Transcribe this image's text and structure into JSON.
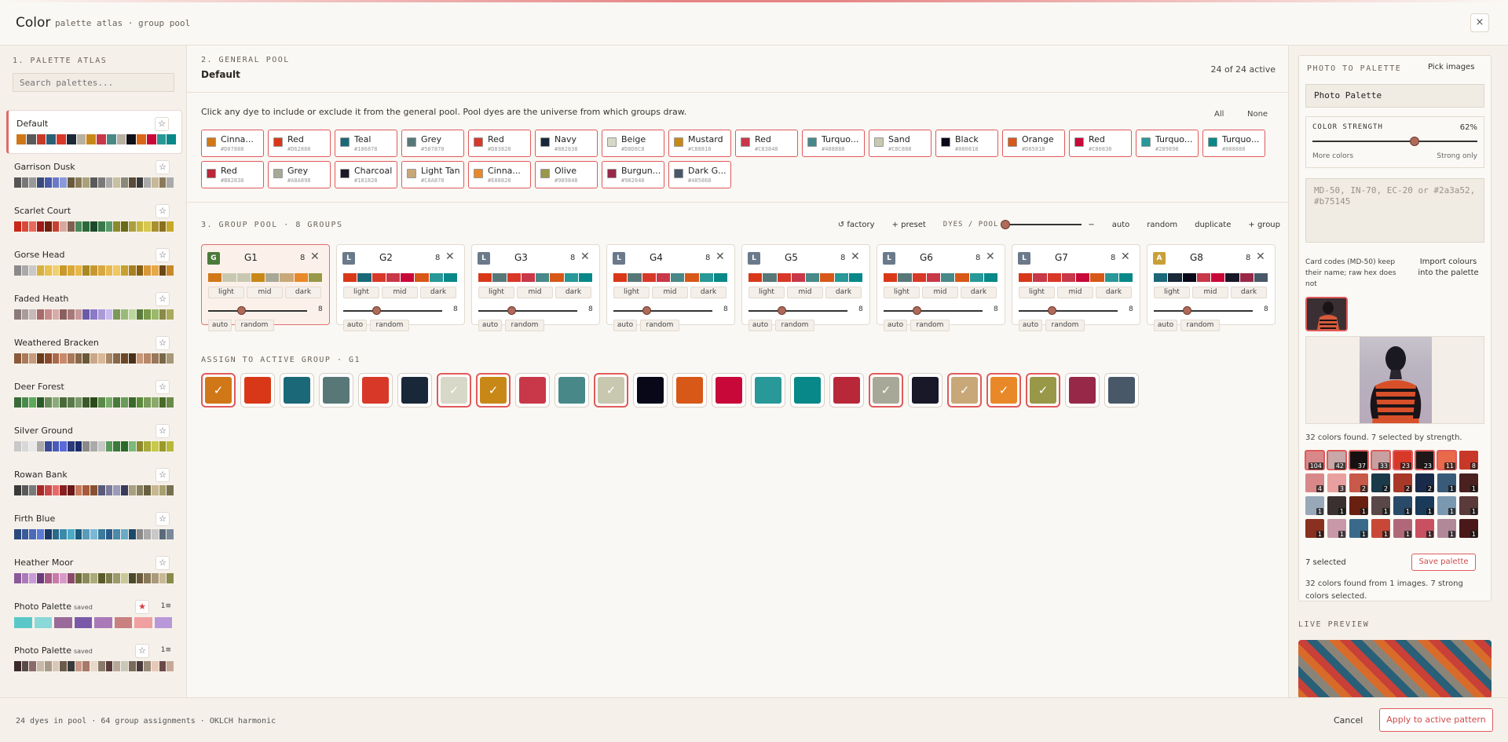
{
  "header": {
    "title": "Color",
    "subtitle": "palette atlas · group pool",
    "close_label": "×"
  },
  "sidebar": {
    "section_label": "1. PALETTE ATLAS",
    "search_placeholder": "Search palettes...",
    "palettes": [
      {
        "name": "Default",
        "active": true,
        "starred": false,
        "colors": [
          "#d07818",
          "#5a5a5a",
          "#c83a28",
          "#2a5f78",
          "#d83828",
          "#1a2838",
          "#b8b0a0",
          "#c88818",
          "#c83848",
          "#4a8888",
          "#b8b0a0",
          "#101018",
          "#d86818",
          "#c80838",
          "#289898",
          "#088888"
        ]
      },
      {
        "name": "Garrison Dusk",
        "starred": false,
        "colors": [
          "#555",
          "#777",
          "#999",
          "#3a4a7a",
          "#4a5aaa",
          "#6a7ac8",
          "#8a9ad8",
          "#6a5a3a",
          "#8a7a5a",
          "#aaa07a",
          "#5a5a5a",
          "#7a7a7a",
          "#aaa",
          "#c8c0a0",
          "#8a8878",
          "#5a4a3a",
          "#3a3a3a",
          "#aaa",
          "#c8b898",
          "#8a7a5a",
          "#aaa"
        ]
      },
      {
        "name": "Scarlet Court",
        "starred": false,
        "colors": [
          "#c8281a",
          "#d84a3a",
          "#e86a5a",
          "#a01818",
          "#702010",
          "#c84030",
          "#d8a8a0",
          "#806050",
          "#4a8a5a",
          "#2a6a3a",
          "#1a4a2a",
          "#3a7a4a",
          "#5a9a6a",
          "#8a8a2a",
          "#6a6a1a",
          "#aaa040",
          "#c8b840",
          "#d8c850",
          "#a89030",
          "#887020",
          "#c8a828"
        ]
      },
      {
        "name": "Gorse Head",
        "starred": false,
        "colors": [
          "#8a8a8a",
          "#aaa",
          "#c8c8c8",
          "#d8b040",
          "#e8c050",
          "#f0d070",
          "#c89828",
          "#d8a838",
          "#e8b848",
          "#a88820",
          "#c89830",
          "#d8a840",
          "#e8b850",
          "#f0c860",
          "#c8a030",
          "#a88020",
          "#886010",
          "#d89838",
          "#e8a848",
          "#6a4818",
          "#c88828"
        ]
      },
      {
        "name": "Faded Heath",
        "starred": false,
        "colors": [
          "#8a7a7a",
          "#aa9a9a",
          "#c8b8b8",
          "#a86a6a",
          "#c88a8a",
          "#d8aaaa",
          "#886060",
          "#a87878",
          "#c89898",
          "#6a5aa8",
          "#8a7ac8",
          "#aa9ad8",
          "#c8baf0",
          "#7a9a5a",
          "#9aba7a",
          "#bad89a",
          "#5a7a3a",
          "#7a9a4a",
          "#9aba6a",
          "#8a8a4a",
          "#aaaa5a"
        ]
      },
      {
        "name": "Weathered Bracken",
        "starred": false,
        "colors": [
          "#8a5a3a",
          "#aa7a5a",
          "#c89a7a",
          "#6a3a1a",
          "#8a4a2a",
          "#aa6a4a",
          "#c88a6a",
          "#a87858",
          "#886848",
          "#6a5838",
          "#c8a888",
          "#d8b898",
          "#a88868",
          "#886848",
          "#6a4828",
          "#4a3018",
          "#c89878",
          "#b88868",
          "#987858",
          "#786848",
          "#a89878"
        ]
      },
      {
        "name": "Deer Forest",
        "starred": false,
        "colors": [
          "#3a6a3a",
          "#4a8a4a",
          "#5aaa5a",
          "#2a5a2a",
          "#6a8a5a",
          "#8aaa7a",
          "#4a6a3a",
          "#5a7a4a",
          "#7a9a6a",
          "#3a5a2a",
          "#2a4a1a",
          "#5a8a4a",
          "#7aaa6a",
          "#4a7a3a",
          "#6a9a5a",
          "#3a6a2a",
          "#5a8a3a",
          "#7a9a5a",
          "#8aaa6a",
          "#4a6a2a",
          "#6a8a4a"
        ]
      },
      {
        "name": "Silver Ground",
        "starred": false,
        "colors": [
          "#c8c8c8",
          "#d8d8d8",
          "#e8e8e8",
          "#aaaaaa",
          "#3a4a9a",
          "#4a5aba",
          "#5a6ad8",
          "#2a3a7a",
          "#1a2a6a",
          "#8a8a8a",
          "#aaaaaa",
          "#c8c8c8",
          "#5a9a5a",
          "#3a7a3a",
          "#2a6a2a",
          "#7aba7a",
          "#8a8a2a",
          "#aaaa3a",
          "#c8c84a",
          "#9a9a2a",
          "#b8b838"
        ]
      },
      {
        "name": "Rowan Bank",
        "starred": false,
        "colors": [
          "#3a3a3a",
          "#5a5a5a",
          "#7a7a7a",
          "#a82828",
          "#c84848",
          "#e86868",
          "#882020",
          "#6a1818",
          "#c87a5a",
          "#a85a3a",
          "#885030",
          "#5a5a7a",
          "#7a7a9a",
          "#9a9aba",
          "#3a3a5a",
          "#a8a080",
          "#888060",
          "#686040",
          "#c8b890",
          "#a8a070",
          "#787050"
        ]
      },
      {
        "name": "Firth Blue",
        "starred": false,
        "colors": [
          "#2a4a7a",
          "#3a5a9a",
          "#4a6aba",
          "#5a7ad8",
          "#1a3a6a",
          "#2a6a8a",
          "#3a8aaa",
          "#4aaac8",
          "#1a5a7a",
          "#5a9aba",
          "#7ab8d8",
          "#3a7a9a",
          "#2a5a8a",
          "#4a8aaa",
          "#6aaac8",
          "#1a4a6a",
          "#8a8a8a",
          "#aaaaaa",
          "#c8c8c8",
          "#5a6a7a",
          "#7a8a9a"
        ]
      },
      {
        "name": "Heather Moor",
        "starred": false,
        "colors": [
          "#8a5a9a",
          "#aa7aba",
          "#c89ad8",
          "#6a3a7a",
          "#a85a8a",
          "#c87aaa",
          "#d89ac8",
          "#8a4a6a",
          "#6a6a3a",
          "#8a8a5a",
          "#aaaa7a",
          "#5a5a2a",
          "#7a7a4a",
          "#9a9a6a",
          "#c8c89a",
          "#4a4a2a",
          "#6a5a3a",
          "#8a7a5a",
          "#aa9a7a",
          "#c8b898",
          "#8a8a4a"
        ]
      },
      {
        "name": "Photo Palette",
        "saved": "saved",
        "starred": true,
        "count_label": "1≡",
        "big": true,
        "colors": [
          "#5ac8c8",
          "#8ad8d8",
          "#9a6a9a",
          "#7a5aa8",
          "#aa7ab8",
          "#c88080",
          "#f0a0a0",
          "#b898d8"
        ]
      },
      {
        "name": "Photo Palette",
        "saved": "saved",
        "starred": false,
        "count_label": "1≡",
        "colors": [
          "#3a2a2a",
          "#5a4a4a",
          "#8a6a6a",
          "#c8b8a8",
          "#aa9a8a",
          "#d8c8b8",
          "#6a5a4a",
          "#3a3a3a",
          "#c89888",
          "#a87868",
          "#e8d8c8",
          "#8a7a6a",
          "#5a3a3a",
          "#b8a898",
          "#c8c8b8",
          "#7a6a5a",
          "#4a3a3a",
          "#9a8a7a",
          "#e8c8b8",
          "#6a4a4a",
          "#c8a898"
        ]
      }
    ]
  },
  "general": {
    "section_label": "2. GENERAL POOL",
    "title": "Default",
    "count_text": "24 of 24 active",
    "hint": "Click any dye to include or exclude it from the general pool. Pool dyes are the universe from which groups draw.",
    "all_label": "All",
    "none_label": "None",
    "dyes": [
      {
        "name": "Cinna...",
        "hex": "#D07888",
        "color": "#d07818"
      },
      {
        "name": "Red",
        "hex": "#D62888",
        "color": "#d83818"
      },
      {
        "name": "Teal",
        "hex": "#186878",
        "color": "#1a6878"
      },
      {
        "name": "Grey",
        "hex": "#587878",
        "color": "#587878"
      },
      {
        "name": "Red",
        "hex": "#D83828",
        "color": "#d83828"
      },
      {
        "name": "Navy",
        "hex": "#882838",
        "color": "#182838"
      },
      {
        "name": "Beige",
        "hex": "#D8D8C8",
        "color": "#d8d8c8"
      },
      {
        "name": "Mustard",
        "hex": "#C88818",
        "color": "#c88818"
      },
      {
        "name": "Red",
        "hex": "#C83848",
        "color": "#c83848"
      },
      {
        "name": "Turquo...",
        "hex": "#488888",
        "color": "#488888"
      },
      {
        "name": "Sand",
        "hex": "#C8C888",
        "color": "#c8c8b0"
      },
      {
        "name": "Black",
        "hex": "#080818",
        "color": "#080818"
      },
      {
        "name": "Orange",
        "hex": "#D85818",
        "color": "#d85818"
      },
      {
        "name": "Red",
        "hex": "#C80838",
        "color": "#c80838"
      },
      {
        "name": "Turquo...",
        "hex": "#289898",
        "color": "#289898"
      },
      {
        "name": "Turquo...",
        "hex": "#088888",
        "color": "#088888"
      },
      {
        "name": "Red",
        "hex": "#B82838",
        "color": "#b82838"
      },
      {
        "name": "Grey",
        "hex": "#A8A898",
        "color": "#a8a898"
      },
      {
        "name": "Charcoal",
        "hex": "#181828",
        "color": "#181828"
      },
      {
        "name": "Light Tan",
        "hex": "#C8A878",
        "color": "#c8a878"
      },
      {
        "name": "Cinna...",
        "hex": "#E88828",
        "color": "#e88828"
      },
      {
        "name": "Olive",
        "hex": "#989848",
        "color": "#989848"
      },
      {
        "name": "Burgun...",
        "hex": "#982848",
        "color": "#982848"
      },
      {
        "name": "Dark G...",
        "hex": "#485868",
        "color": "#485868"
      }
    ]
  },
  "groups": {
    "section_label": "3. GROUP POOL · 8 GROUPS",
    "factory_label": "↺ factory",
    "preset_label": "+ preset",
    "dyes_pool_label": "DYES / POOL",
    "dash": "−",
    "auto_label": "auto",
    "random_label": "random",
    "duplicate_label": "duplicate",
    "add_label": "+ group",
    "cards": [
      {
        "badge": "G",
        "badge_color": "#4a7a3a",
        "name": "G1",
        "count": "8",
        "active": true,
        "slider_val": "8",
        "colors": [
          "#d07818",
          "#c8c8b0",
          "#c8c8b0",
          "#c88818",
          "#a8a898",
          "#c8a878",
          "#e88828",
          "#989848"
        ]
      },
      {
        "badge": "L",
        "badge_color": "#6a7a8a",
        "name": "G2",
        "count": "8",
        "slider_val": "8",
        "colors": [
          "#d83818",
          "#1a6878",
          "#d83828",
          "#c83848",
          "#c80838",
          "#d85818",
          "#289898",
          "#088888"
        ]
      },
      {
        "badge": "L",
        "badge_color": "#6a7a8a",
        "name": "G3",
        "count": "8",
        "slider_val": "8",
        "colors": [
          "#d83818",
          "#587878",
          "#d83828",
          "#c83848",
          "#488888",
          "#d85818",
          "#289898",
          "#088888"
        ]
      },
      {
        "badge": "L",
        "badge_color": "#6a7a8a",
        "name": "G4",
        "count": "8",
        "slider_val": "8",
        "colors": [
          "#d83818",
          "#587878",
          "#d83828",
          "#c83848",
          "#488888",
          "#d85818",
          "#289898",
          "#088888"
        ]
      },
      {
        "badge": "L",
        "badge_color": "#6a7a8a",
        "name": "G5",
        "count": "8",
        "slider_val": "8",
        "colors": [
          "#d83818",
          "#587878",
          "#d83828",
          "#c83848",
          "#488888",
          "#d85818",
          "#289898",
          "#088888"
        ]
      },
      {
        "badge": "L",
        "badge_color": "#6a7a8a",
        "name": "G6",
        "count": "8",
        "slider_val": "8",
        "colors": [
          "#d83818",
          "#587878",
          "#d83828",
          "#c83848",
          "#488888",
          "#d85818",
          "#289898",
          "#088888"
        ]
      },
      {
        "badge": "L",
        "badge_color": "#6a7a8a",
        "name": "G7",
        "count": "8",
        "slider_val": "8",
        "colors": [
          "#d83818",
          "#c83848",
          "#d83828",
          "#c83848",
          "#c80838",
          "#d85818",
          "#289898",
          "#088888"
        ]
      },
      {
        "badge": "A",
        "badge_color": "#c8a038",
        "name": "G8",
        "count": "8",
        "slider_val": "8",
        "colors": [
          "#1a6878",
          "#182838",
          "#080818",
          "#c83848",
          "#c80838",
          "#181828",
          "#982848",
          "#485868"
        ]
      }
    ],
    "light_label": "light",
    "mid_label": "mid",
    "dark_label": "dark",
    "assign_label": "ASSIGN TO ACTIVE GROUP · G1",
    "assign": [
      {
        "color": "#d07818",
        "sel": true
      },
      {
        "color": "#d83818",
        "sel": false
      },
      {
        "color": "#1a6878",
        "sel": false
      },
      {
        "color": "#587878",
        "sel": false
      },
      {
        "color": "#d83828",
        "sel": false
      },
      {
        "color": "#182838",
        "sel": false
      },
      {
        "color": "#d8d8c8",
        "sel": true
      },
      {
        "color": "#c88818",
        "sel": true
      },
      {
        "color": "#c83848",
        "sel": false
      },
      {
        "color": "#488888",
        "sel": false
      },
      {
        "color": "#c8c8b0",
        "sel": true
      },
      {
        "color": "#080818",
        "sel": false
      },
      {
        "color": "#d85818",
        "sel": false
      },
      {
        "color": "#c80838",
        "sel": false
      },
      {
        "color": "#289898",
        "sel": false
      },
      {
        "color": "#088888",
        "sel": false
      },
      {
        "color": "#b82838",
        "sel": false
      },
      {
        "color": "#a8a898",
        "sel": true
      },
      {
        "color": "#181828",
        "sel": false
      },
      {
        "color": "#c8a878",
        "sel": true
      },
      {
        "color": "#e88828",
        "sel": true
      },
      {
        "color": "#989848",
        "sel": true
      },
      {
        "color": "#982848",
        "sel": false
      },
      {
        "color": "#485868",
        "sel": false
      }
    ],
    "check_glyph": "✓"
  },
  "photo": {
    "section_label": "PHOTO TO PALETTE",
    "pick_label": "Pick images",
    "palette_name": "Photo Palette",
    "strength_label": "COLOR STRENGTH",
    "strength_value": "62%",
    "strength_fraction": 0.62,
    "more_label": "More colors",
    "strong_label": "Strong only",
    "codes_placeholder": "MD-50, IN-70, EC-20 or #2a3a52, #b75145",
    "card_note": "Card codes (MD-50) keep their name; raw hex does not",
    "import_label": "Import colours into the palette",
    "found_text": "32 colors found. 7 selected by strength.",
    "extracted": [
      {
        "c": "#d88888",
        "n": "104",
        "s": true
      },
      {
        "c": "#c8a8a8",
        "n": "42",
        "s": true
      },
      {
        "c": "#181010",
        "n": "37",
        "s": true
      },
      {
        "c": "#c8a0a0",
        "n": "33",
        "s": true
      },
      {
        "c": "#d83828",
        "n": "23",
        "s": true
      },
      {
        "c": "#201818",
        "n": "23",
        "s": true
      },
      {
        "c": "#e86a4a",
        "n": "11",
        "s": true
      },
      {
        "c": "#c83828",
        "n": "8",
        "s": false
      },
      {
        "c": "#d88888",
        "n": "4",
        "s": false
      },
      {
        "c": "#e8a0a0",
        "n": "3",
        "s": false
      },
      {
        "c": "#c85848",
        "n": "2",
        "s": false
      },
      {
        "c": "#1a3a4a",
        "n": "2",
        "s": false
      },
      {
        "c": "#a83828",
        "n": "2",
        "s": false
      },
      {
        "c": "#1a2a4a",
        "n": "2",
        "s": false
      },
      {
        "c": "#3a5a7a",
        "n": "1",
        "s": false
      },
      {
        "c": "#4a2020",
        "n": "1",
        "s": false
      },
      {
        "c": "#98a8b8",
        "n": "1",
        "s": false
      },
      {
        "c": "#3a3030",
        "n": "1",
        "s": false
      },
      {
        "c": "#6a2010",
        "n": "1",
        "s": false
      },
      {
        "c": "#5a4848",
        "n": "1",
        "s": false
      },
      {
        "c": "#2a4a6a",
        "n": "1",
        "s": false
      },
      {
        "c": "#1a3a5a",
        "n": "1",
        "s": false
      },
      {
        "c": "#7a98b0",
        "n": "1",
        "s": false
      },
      {
        "c": "#5a3a3a",
        "n": "1",
        "s": false
      },
      {
        "c": "#8a3020",
        "n": "1",
        "s": false
      },
      {
        "c": "#c898a8",
        "n": "1",
        "s": false
      },
      {
        "c": "#3a6a8a",
        "n": "1",
        "s": false
      },
      {
        "c": "#c84838",
        "n": "1",
        "s": false
      },
      {
        "c": "#b06878",
        "n": "1",
        "s": false
      },
      {
        "c": "#c85060",
        "n": "1",
        "s": false
      },
      {
        "c": "#b08898",
        "n": "1",
        "s": false
      },
      {
        "c": "#4a1818",
        "n": "1",
        "s": false
      }
    ],
    "selected_text": "7 selected",
    "save_label": "Save palette",
    "summary": "32 colors found from 1 images. 7 strong colors selected.",
    "live_label": "LIVE PREVIEW"
  },
  "footer": {
    "stats": "24 dyes in pool · 64 group assignments · OKLCH harmonic",
    "cancel_label": "Cancel",
    "apply_label": "Apply to active pattern"
  }
}
